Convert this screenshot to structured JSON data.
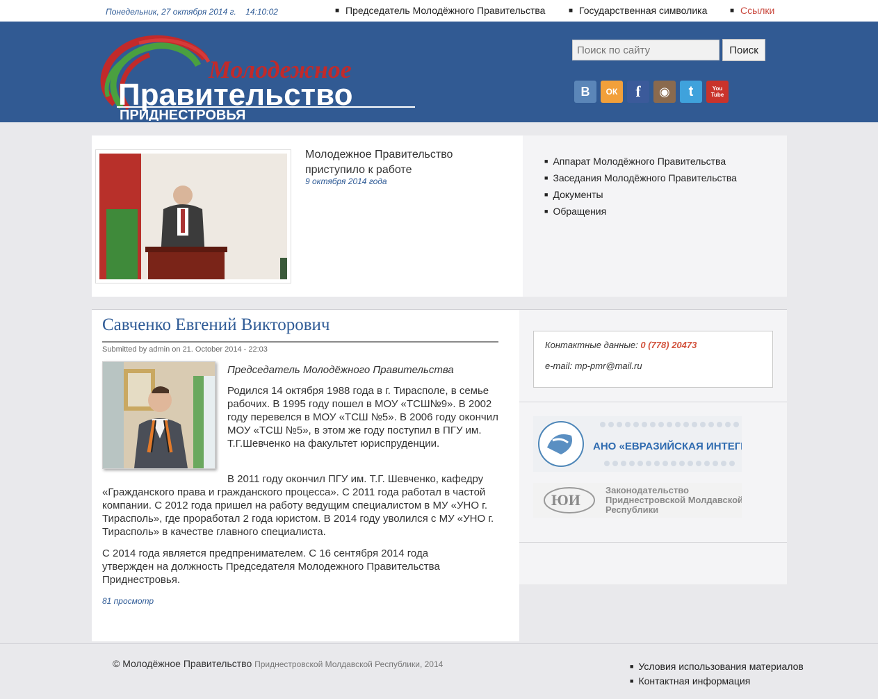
{
  "topbar": {
    "date": "Понедельник, 27 октября 2014 г.",
    "time": "14:10:02",
    "links": [
      "Председатель Молодёжного Правительства",
      "Государственная символика",
      "Ссылки"
    ]
  },
  "header": {
    "logo_line1": "Молодежное",
    "logo_line2": "Правительство",
    "logo_line3": "ПРИДНЕСТРОВЬЯ",
    "search_placeholder": "Поиск по сайту",
    "search_button": "Поиск",
    "social": [
      {
        "icon": "vk-icon",
        "glyph": "В",
        "color": "#5b86b8"
      },
      {
        "icon": "odnoklassniki-icon",
        "glyph": "ОК",
        "color": "#f2a03a"
      },
      {
        "icon": "facebook-icon",
        "glyph": "f",
        "color": "#3b5a9a"
      },
      {
        "icon": "instagram-icon",
        "glyph": "◉",
        "color": "#8a6a4e"
      },
      {
        "icon": "twitter-icon",
        "glyph": "t",
        "color": "#3fa2dc"
      },
      {
        "icon": "youtube-icon",
        "glyph": "You Tube",
        "color": "#c9332b"
      }
    ]
  },
  "news": {
    "title": "Молодежное Правительство приступило к работе",
    "date": "9 октября 2014 года"
  },
  "menu": [
    "Аппарат Молодёжного Правительства",
    "Заседания Молодёжного Правительства",
    "Документы",
    "Обращения"
  ],
  "article": {
    "title": "Савченко Евгений Викторович",
    "submitted": "Submitted by admin on 21. October 2014 - 22:03",
    "position": "Председатель Молодёжного Правительства",
    "p1": "Родился 14 октября  1988 года в г. Тирасполе, в семье рабочих. В 1995 году пошел в МОУ «ТСШ№9». В 2002 году перевелся в МОУ «ТСШ №5». В 2006 году окончил МОУ «ТСШ №5», в этом же году поступил в ПГУ им. Т.Г.Шевченко на факультет юриспруденции.",
    "p2": "В 2011 году окончил ПГУ им. Т.Г. Шевченко, кафедру «Гражданского права и гражданского процесса». С 2011 года работал в частой компании. С 2012 года пришел на работу ведущим специалистом в МУ «УНО г. Тирасполь», где проработал 2 года юристом. В 2014 году уволился с МУ «УНО г. Тирасполь» в качестве главного специалиста.",
    "p3": "С 2014 года является предпренимателем. С  16 сентября 2014 года утвержден на должность Председателя Молодежного Правительства Приднестровья.",
    "views": "81 просмотр"
  },
  "contacts": {
    "phone_label": "Контактные данные:",
    "phone": "0 (778) 20473",
    "email": "e-mail: mp-pmr@mail.ru"
  },
  "banners": {
    "eurasia": "АНО «ЕВРАЗИЙСКАЯ ИНТЕГРАЦИЯ»",
    "law_line1": "Законодательство",
    "law_line2": "Приднестровской Молдавской",
    "law_line3": "Республики"
  },
  "footer": {
    "copy_main": "© Молодёжное Правительство",
    "copy_rest": "Приднестровской Молдавской Республики, 2014",
    "links": [
      "Условия использования материалов",
      "Контактная информация"
    ]
  }
}
